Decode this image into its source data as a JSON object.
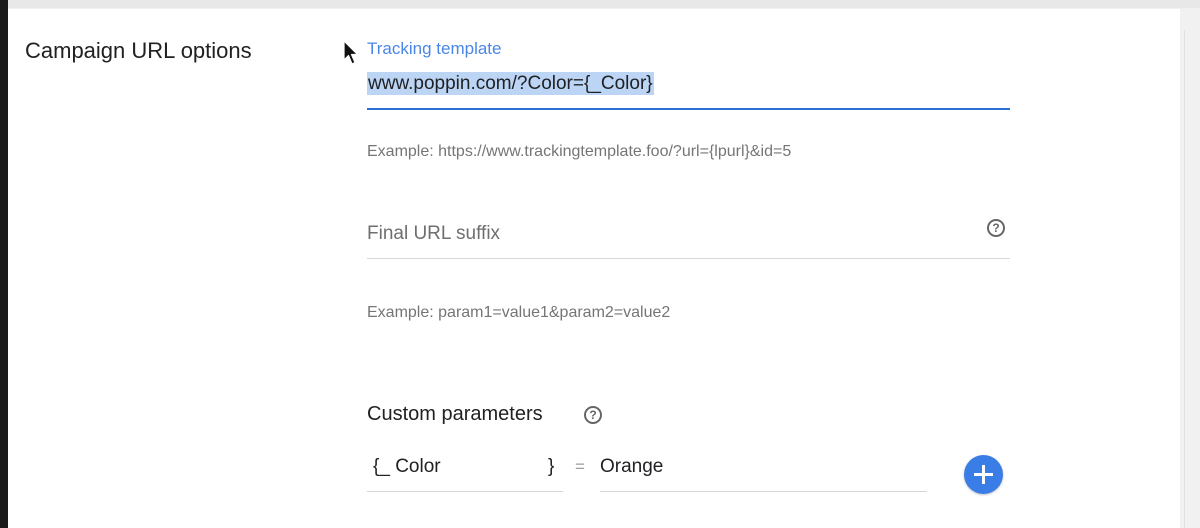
{
  "section": {
    "title": "Campaign URL options"
  },
  "tracking_template": {
    "label": "Tracking template",
    "value": "www.poppin.com/?Color={_Color}",
    "example": "Example: https://www.trackingtemplate.foo/?url={lpurl}&id=5"
  },
  "final_url_suffix": {
    "placeholder": "Final URL suffix",
    "example": "Example: param1=value1&param2=value2"
  },
  "custom_parameters": {
    "heading": "Custom parameters",
    "rows": [
      {
        "key_prefix": "{_",
        "key": "Color",
        "key_suffix": "}",
        "separator": "=",
        "value": "Orange"
      }
    ]
  },
  "icons": {
    "help": "?",
    "add": "plus-icon"
  },
  "colors": {
    "accent": "#3b7de6",
    "label_blue": "#4a86e8",
    "selection": "#bcd5f5"
  }
}
